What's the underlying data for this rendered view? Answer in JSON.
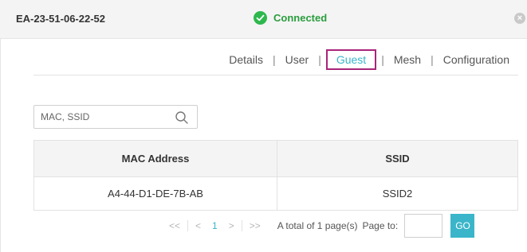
{
  "header": {
    "device_name": "EA-23-51-06-22-52",
    "status": "Connected"
  },
  "tabs": [
    {
      "label": "Details"
    },
    {
      "label": "User"
    },
    {
      "label": "Guest"
    },
    {
      "label": "Mesh"
    },
    {
      "label": "Configuration"
    }
  ],
  "active_tab": "Guest",
  "search": {
    "placeholder": "MAC, SSID",
    "value": ""
  },
  "table": {
    "headers": [
      "MAC Address",
      "SSID"
    ],
    "rows": [
      [
        "A4-44-D1-DE-7B-AB",
        "SSID2"
      ]
    ]
  },
  "pagination": {
    "first": "<<",
    "prev": "<",
    "current_page": "1",
    "next": ">",
    "last": ">>",
    "total_text": "A total of 1 page(s)",
    "page_to_label": "Page to:",
    "page_input_value": "",
    "go_label": "GO"
  },
  "colors": {
    "accent": "#3ab5c9",
    "status_green": "#2db84d",
    "highlight_box": "#a8257a"
  }
}
